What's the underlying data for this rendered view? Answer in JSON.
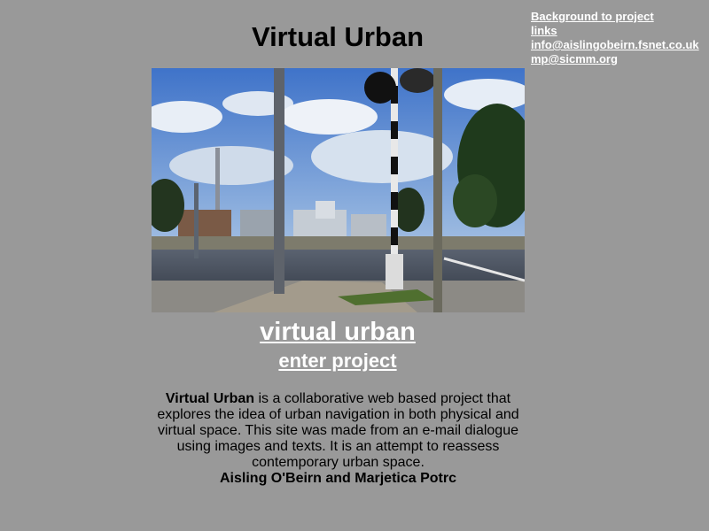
{
  "header": {
    "title": "Virtual Urban"
  },
  "top_links": [
    {
      "label": "Background to project"
    },
    {
      "label": "links"
    },
    {
      "label": "info@aislingobeirn.fsnet.co.uk"
    },
    {
      "label": "mp@sicmm.org"
    }
  ],
  "main": {
    "project_link": "virtual urban",
    "enter_link": "enter project",
    "description_bold": "Virtual Urban",
    "description_rest": " is a collaborative web based project that explores the idea of urban navigation in both physical and virtual space. This site was made from an e-mail dialogue using images and texts. It is an attempt to reassess contemporary urban space.",
    "authors": "Aisling O'Beirn and Marjetica Potrc"
  },
  "colors": {
    "background": "#999999",
    "link": "#ffffff",
    "text": "#000000"
  }
}
